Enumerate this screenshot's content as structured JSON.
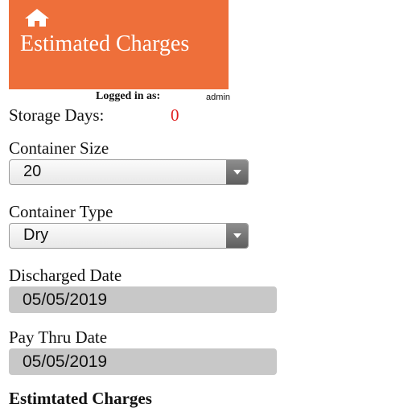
{
  "colors": {
    "brand": "#ee6f3a",
    "value_red": "#e02020",
    "input_bg": "#c8c8c8"
  },
  "header": {
    "home_icon": "home-icon",
    "title": "Estimated Charges"
  },
  "session": {
    "logged_in_label": "Logged in as:",
    "user": "admin"
  },
  "storage": {
    "label": "Storage Days:",
    "value": "0"
  },
  "container_size": {
    "label": "Container Size",
    "selected": "20"
  },
  "container_type": {
    "label": "Container Type",
    "selected": "Dry"
  },
  "discharged_date": {
    "label": "Discharged Date",
    "value": "05/05/2019"
  },
  "pay_thru_date": {
    "label": "Pay Thru Date",
    "value": "05/05/2019"
  },
  "charges_section": {
    "title": "Estimtated Charges"
  }
}
